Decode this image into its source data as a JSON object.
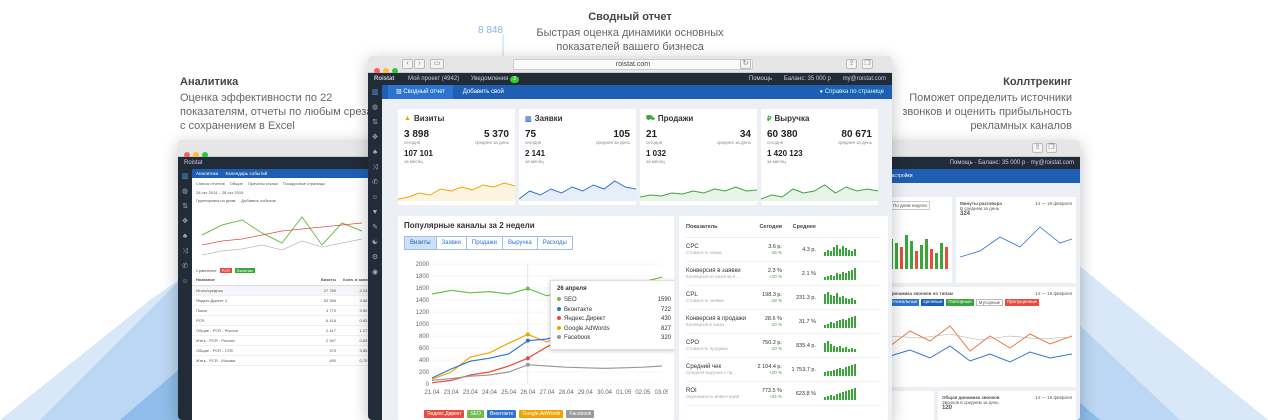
{
  "captions": {
    "center_number": "8 848",
    "center_title": "Сводный отчет",
    "center_text": "Быстрая оценка динамики основных показателей вашего бизнеса",
    "left_title": "Аналитика",
    "left_text": "Оценка эффективности по 22 показателям, отчеты по любым срезам с сохранением в Excel",
    "right_title": "Коллтрекинг",
    "right_text": "Поможет определить источники звонков и оценить прибыльность рекламных каналов"
  },
  "browser": {
    "url": "roistat.com"
  },
  "topbar": {
    "logo": "Roistat",
    "project": "Мой проект (4942)",
    "notifications": "Уведомления",
    "notif_count": "3",
    "help": "Помощь",
    "balance": "Баланс: 35 000 р",
    "email": "my@roistat.com"
  },
  "nav": {
    "tab_summary": "Сводный отчет",
    "tab_add": "Добавить свой",
    "help_link": "Справка по странице"
  },
  "kpis": [
    {
      "title": "Визиты",
      "icon": "warning-icon",
      "color": "#f0a400",
      "today": "3 898",
      "today_label": "сегодня",
      "avg": "5 370",
      "avg_label": "среднее за день",
      "month": "107 101",
      "month_label": "за месяц"
    },
    {
      "title": "Заявки",
      "icon": "bar-chart-icon",
      "color": "#2d74d1",
      "today": "75",
      "today_label": "сегодня",
      "avg": "105",
      "avg_label": "среднее за день",
      "month": "2 141",
      "month_label": "за месяц"
    },
    {
      "title": "Продажи",
      "icon": "cart-icon",
      "color": "#3aa63a",
      "today": "21",
      "today_label": "сегодня",
      "avg": "34",
      "avg_label": "среднее за день",
      "month": "1 032",
      "month_label": "за месяц"
    },
    {
      "title": "Выручка",
      "icon": "ruble-icon",
      "color": "#3aa63a",
      "today": "60 380",
      "today_label": "сегодня",
      "avg": "80 671",
      "avg_label": "среднее за день",
      "month": "1 420 123",
      "month_label": "за месяц"
    }
  ],
  "channels": {
    "title": "Популярные каналы за 2 недели",
    "tabs": [
      "Визиты",
      "Заявки",
      "Продажи",
      "Выручка",
      "Расходы"
    ],
    "tooltip": {
      "date": "26 апреля",
      "rows": [
        {
          "name": "SEO",
          "value": "1590",
          "color": "#6cc04a"
        },
        {
          "name": "Вконтакте",
          "value": "722",
          "color": "#2d74d1"
        },
        {
          "name": "Яндекс.Директ",
          "value": "430",
          "color": "#e74c3c"
        },
        {
          "name": "Google.AdWords",
          "value": "827",
          "color": "#f0a400"
        },
        {
          "name": "Facebook",
          "value": "320",
          "color": "#999999"
        }
      ]
    },
    "legend": [
      {
        "name": "Яндекс.Директ",
        "color": "#e74c3c"
      },
      {
        "name": "SEO",
        "color": "#6cc04a"
      },
      {
        "name": "Вконтакте",
        "color": "#2d74d1"
      },
      {
        "name": "Google.AdWords",
        "color": "#f0a400"
      },
      {
        "name": "Facebook",
        "color": "#999999"
      }
    ]
  },
  "chart_data": {
    "type": "line",
    "title": "Популярные каналы за 2 недели",
    "x": [
      "21.04",
      "23.04",
      "23.04",
      "24.04",
      "25.04",
      "26.04",
      "27.04",
      "28.04",
      "29.04",
      "30.04",
      "01.05",
      "02.05",
      "03.05"
    ],
    "ylim": [
      0,
      2000
    ],
    "yticks": [
      0,
      200,
      400,
      600,
      800,
      1000,
      1200,
      1400,
      1600,
      1800,
      2000
    ],
    "series": [
      {
        "name": "SEO",
        "color": "#6cc04a",
        "values": [
          1500,
          1560,
          1520,
          1540,
          1500,
          1590,
          1470,
          1560,
          1600,
          1640,
          1610,
          1700,
          1780
        ]
      },
      {
        "name": "Яндекс.Директ",
        "color": "#e74c3c",
        "values": [
          20,
          60,
          150,
          200,
          300,
          430,
          620,
          780,
          900,
          1050,
          1200,
          1350,
          1500
        ]
      },
      {
        "name": "Google.AdWords",
        "color": "#f0a400",
        "values": [
          80,
          200,
          450,
          520,
          680,
          827,
          700,
          880,
          950,
          1000,
          1050,
          1150,
          1250
        ]
      },
      {
        "name": "Вконтакте",
        "color": "#2d74d1",
        "values": [
          100,
          250,
          380,
          430,
          500,
          722,
          750,
          850,
          900,
          880,
          950,
          1000,
          1100
        ]
      },
      {
        "name": "Facebook",
        "color": "#999999",
        "values": [
          60,
          90,
          130,
          150,
          200,
          320,
          300,
          280,
          270,
          260,
          270,
          280,
          300
        ]
      }
    ]
  },
  "metrics": {
    "headers": [
      "Показатель",
      "Сегодня",
      "Среднее"
    ],
    "rows": [
      {
        "name": "CPC",
        "desc": "Стоимость клика",
        "today": "3.6 р.",
        "delta": "-16 %",
        "avg": "4.3 р.",
        "bars": [
          4,
          6,
          5,
          9,
          11,
          7,
          10,
          8,
          6,
          5,
          7
        ]
      },
      {
        "name": "Конверсия в заявки",
        "desc": "Конверсия из визитов в ...",
        "today": "2.3 %",
        "delta": "+10 %",
        "avg": "2.1 %",
        "bars": [
          3,
          4,
          5,
          4,
          7,
          6,
          8,
          7,
          9,
          10,
          12
        ]
      },
      {
        "name": "CPL",
        "desc": "Стоимость заявки",
        "today": "198.3 р.",
        "delta": "-18 %",
        "avg": "231.3 р.",
        "bars": [
          10,
          12,
          9,
          8,
          11,
          7,
          8,
          6,
          5,
          6,
          4
        ]
      },
      {
        "name": "Конверсия в продажи",
        "desc": "Конверсия в заказ",
        "today": "28.6 %",
        "delta": "-10 %",
        "avg": "31.7 %",
        "bars": [
          3,
          4,
          6,
          5,
          7,
          8,
          9,
          8,
          10,
          11,
          12
        ]
      },
      {
        "name": "CPO",
        "desc": "Стоимость продажи",
        "today": "750.2 р.",
        "delta": "-10 %",
        "avg": "835.4 р.",
        "bars": [
          9,
          11,
          8,
          6,
          5,
          6,
          4,
          5,
          3,
          4,
          3
        ]
      },
      {
        "name": "Средний чек",
        "desc": "Средняя выручка с пр...",
        "today": "2 104.4 р.",
        "delta": "+20 %",
        "avg": "1 753.7 р.",
        "bars": [
          4,
          5,
          5,
          6,
          7,
          8,
          7,
          9,
          10,
          11,
          12
        ]
      },
      {
        "name": "ROI",
        "desc": "Окупаемость инвестиций",
        "today": "773.5 %",
        "delta": "+24 %",
        "avg": "623.8 %",
        "bars": [
          3,
          4,
          5,
          4,
          6,
          7,
          8,
          9,
          10,
          11,
          12
        ]
      }
    ]
  },
  "left_window": {
    "tabs": [
      "Аналитика",
      "Календарь событий"
    ],
    "filters": [
      "Список отчетов",
      "Общие",
      "Причины отказа",
      "Посадочные страницы"
    ],
    "daterange": "28 окт 2014 – 28 окт 2015",
    "group": "Группировка по дням",
    "add_event": "Добавить событие",
    "compare": "Сравнение",
    "chips": [
      "PCR",
      "Визитам"
    ],
    "cols": [
      "Название",
      "Визиты",
      "Конв. в заявки"
    ],
    "rows": [
      {
        "name": "Итого/средняя",
        "v": "27 789",
        "c": "2.13 %"
      },
      {
        "name": "Яндекс.Директ 2",
        "v": "53 356",
        "c": "3.58 %"
      },
      {
        "name": "Поиск",
        "v": "4 770",
        "c": "3.59 %"
      },
      {
        "name": "PCR",
        "v": "6 418",
        "c": "0.83 %"
      },
      {
        "name": "Общие - PCR - Россия",
        "v": "2 417",
        "c": "1.27 %"
      },
      {
        "name": "Жить - PCR - Россия",
        "v": "2 947",
        "c": "0.69 %"
      },
      {
        "name": "Общие - PCR - СПб",
        "v": "373",
        "c": "3.85 %"
      },
      {
        "name": "Жить - PCR - Москва",
        "v": "450",
        "c": "0.70 %"
      }
    ]
  },
  "right_window": {
    "help": "Помощь",
    "balance": "Баланс: 35 000 р",
    "email": "my@roistat.com",
    "tab": "Настройки",
    "card1_title": "Минуты разговора",
    "card1_period": "14 — 19 февраля",
    "card1_sub": "В среднем за день",
    "card1_value": "324",
    "card1_btn": "По дням недели",
    "card2_title": "Динамика звонков по типам",
    "card2_period": "14 — 19 февраля",
    "chips": [
      "Уникальные",
      "Целевые",
      "Повторные",
      "Мусорные",
      "Пропущенные"
    ],
    "card3_title": "Общая динамика звонков",
    "card3_period": "14 — 19 февраля",
    "card3_sub": "Звонков в среднем за день",
    "card3_value": "120"
  }
}
